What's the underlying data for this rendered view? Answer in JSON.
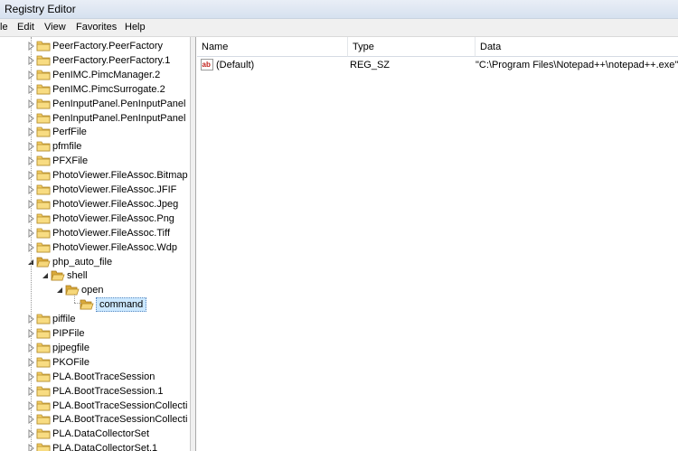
{
  "window": {
    "title": "Registry Editor"
  },
  "menu": [
    "le",
    "Edit",
    "View",
    "Favorites",
    "Help"
  ],
  "tree": [
    {
      "label": "PeerFactory.PeerFactory",
      "level": 0,
      "expander": "collapsed"
    },
    {
      "label": "PeerFactory.PeerFactory.1",
      "level": 0,
      "expander": "collapsed"
    },
    {
      "label": "PenIMC.PimcManager.2",
      "level": 0,
      "expander": "collapsed"
    },
    {
      "label": "PenIMC.PimcSurrogate.2",
      "level": 0,
      "expander": "collapsed"
    },
    {
      "label": "PenInputPanel.PenInputPanel",
      "level": 0,
      "expander": "collapsed"
    },
    {
      "label": "PenInputPanel.PenInputPanel",
      "level": 0,
      "expander": "collapsed"
    },
    {
      "label": "PerfFile",
      "level": 0,
      "expander": "collapsed"
    },
    {
      "label": "pfmfile",
      "level": 0,
      "expander": "collapsed"
    },
    {
      "label": "PFXFile",
      "level": 0,
      "expander": "collapsed"
    },
    {
      "label": "PhotoViewer.FileAssoc.Bitmap",
      "level": 0,
      "expander": "collapsed"
    },
    {
      "label": "PhotoViewer.FileAssoc.JFIF",
      "level": 0,
      "expander": "collapsed"
    },
    {
      "label": "PhotoViewer.FileAssoc.Jpeg",
      "level": 0,
      "expander": "collapsed"
    },
    {
      "label": "PhotoViewer.FileAssoc.Png",
      "level": 0,
      "expander": "collapsed"
    },
    {
      "label": "PhotoViewer.FileAssoc.Tiff",
      "level": 0,
      "expander": "collapsed"
    },
    {
      "label": "PhotoViewer.FileAssoc.Wdp",
      "level": 0,
      "expander": "collapsed"
    },
    {
      "label": "php_auto_file",
      "level": 0,
      "expander": "expanded"
    },
    {
      "label": "shell",
      "level": 1,
      "expander": "expanded"
    },
    {
      "label": "open",
      "level": 2,
      "expander": "expanded"
    },
    {
      "label": "command",
      "level": 3,
      "expander": "none",
      "selected": true
    },
    {
      "label": "piffile",
      "level": 0,
      "expander": "collapsed"
    },
    {
      "label": "PIPFile",
      "level": 0,
      "expander": "collapsed"
    },
    {
      "label": "pjpegfile",
      "level": 0,
      "expander": "collapsed"
    },
    {
      "label": "PKOFile",
      "level": 0,
      "expander": "collapsed"
    },
    {
      "label": "PLA.BootTraceSession",
      "level": 0,
      "expander": "collapsed"
    },
    {
      "label": "PLA.BootTraceSession.1",
      "level": 0,
      "expander": "collapsed"
    },
    {
      "label": "PLA.BootTraceSessionCollecti",
      "level": 0,
      "expander": "collapsed"
    },
    {
      "label": "PLA.BootTraceSessionCollecti",
      "level": 0,
      "expander": "collapsed"
    },
    {
      "label": "PLA.DataCollectorSet",
      "level": 0,
      "expander": "collapsed"
    },
    {
      "label": "PLA.DataCollectorSet.1",
      "level": 0,
      "expander": "collapsed"
    }
  ],
  "list": {
    "columns": {
      "name": "Name",
      "type": "Type",
      "data": "Data"
    },
    "rows": [
      {
        "icon": "string-value-icon",
        "name": "(Default)",
        "type": "REG_SZ",
        "data": "\"C:\\Program Files\\Notepad++\\notepad++.exe\""
      }
    ]
  }
}
